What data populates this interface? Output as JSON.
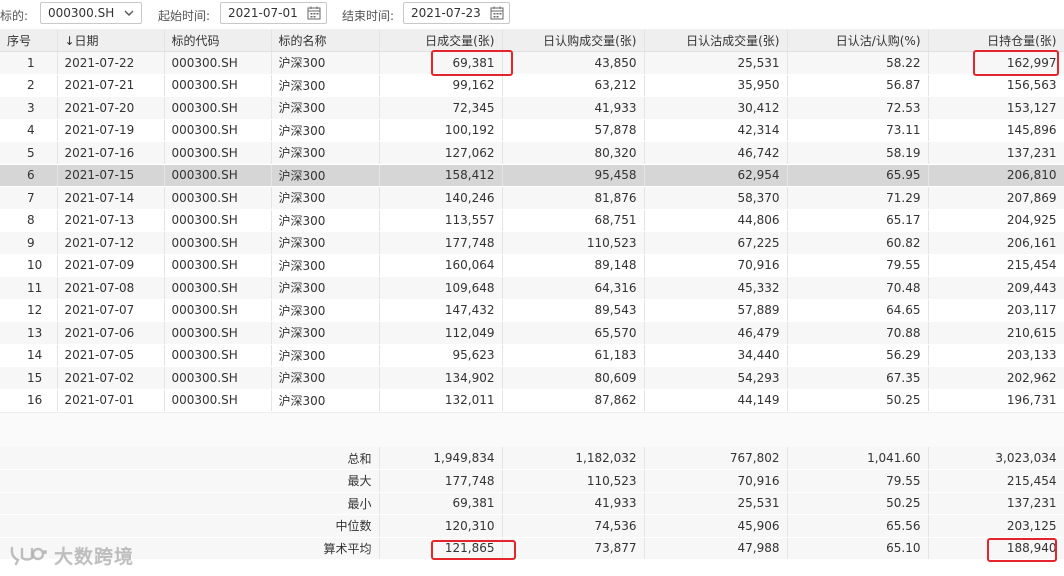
{
  "toolbar": {
    "symbol_label": "标的:",
    "symbol_value": "000300.SH",
    "start_label": "起始时间:",
    "start_date": "2021-07-01",
    "end_label": "结束时间:",
    "end_date": "2021-07-23"
  },
  "table": {
    "columns": [
      "序号",
      "↓日期",
      "标的代码",
      "标的名称",
      "日成交量(张)",
      "日认购成交量(张)",
      "日认沽成交量(张)",
      "日认沽/认购(%)",
      "日持仓量(张)"
    ],
    "sorted_column": "日期",
    "sort_direction": "desc",
    "selected_row": 6,
    "rows": [
      [
        "1",
        "2021-07-22",
        "000300.SH",
        "沪深300",
        "69,381",
        "43,850",
        "25,531",
        "58.22",
        "162,997"
      ],
      [
        "2",
        "2021-07-21",
        "000300.SH",
        "沪深300",
        "99,162",
        "63,212",
        "35,950",
        "56.87",
        "156,563"
      ],
      [
        "3",
        "2021-07-20",
        "000300.SH",
        "沪深300",
        "72,345",
        "41,933",
        "30,412",
        "72.53",
        "153,127"
      ],
      [
        "4",
        "2021-07-19",
        "000300.SH",
        "沪深300",
        "100,192",
        "57,878",
        "42,314",
        "73.11",
        "145,896"
      ],
      [
        "5",
        "2021-07-16",
        "000300.SH",
        "沪深300",
        "127,062",
        "80,320",
        "46,742",
        "58.19",
        "137,231"
      ],
      [
        "6",
        "2021-07-15",
        "000300.SH",
        "沪深300",
        "158,412",
        "95,458",
        "62,954",
        "65.95",
        "206,810"
      ],
      [
        "7",
        "2021-07-14",
        "000300.SH",
        "沪深300",
        "140,246",
        "81,876",
        "58,370",
        "71.29",
        "207,869"
      ],
      [
        "8",
        "2021-07-13",
        "000300.SH",
        "沪深300",
        "113,557",
        "68,751",
        "44,806",
        "65.17",
        "204,925"
      ],
      [
        "9",
        "2021-07-12",
        "000300.SH",
        "沪深300",
        "177,748",
        "110,523",
        "67,225",
        "60.82",
        "206,161"
      ],
      [
        "10",
        "2021-07-09",
        "000300.SH",
        "沪深300",
        "160,064",
        "89,148",
        "70,916",
        "79.55",
        "215,454"
      ],
      [
        "11",
        "2021-07-08",
        "000300.SH",
        "沪深300",
        "109,648",
        "64,316",
        "45,332",
        "70.48",
        "209,443"
      ],
      [
        "12",
        "2021-07-07",
        "000300.SH",
        "沪深300",
        "147,432",
        "89,543",
        "57,889",
        "64.65",
        "203,117"
      ],
      [
        "13",
        "2021-07-06",
        "000300.SH",
        "沪深300",
        "112,049",
        "65,570",
        "46,479",
        "70.88",
        "210,615"
      ],
      [
        "14",
        "2021-07-05",
        "000300.SH",
        "沪深300",
        "95,623",
        "61,183",
        "34,440",
        "56.29",
        "203,133"
      ],
      [
        "15",
        "2021-07-02",
        "000300.SH",
        "沪深300",
        "134,902",
        "80,609",
        "54,293",
        "67.35",
        "202,962"
      ],
      [
        "16",
        "2021-07-01",
        "000300.SH",
        "沪深300",
        "132,011",
        "87,862",
        "44,149",
        "50.25",
        "196,731"
      ]
    ]
  },
  "summary": [
    {
      "label": "总和",
      "values": [
        "1,949,834",
        "1,182,032",
        "767,802",
        "1,041.60",
        "3,023,034"
      ]
    },
    {
      "label": "最大",
      "values": [
        "177,748",
        "110,523",
        "70,916",
        "79.55",
        "215,454"
      ]
    },
    {
      "label": "最小",
      "values": [
        "69,381",
        "41,933",
        "25,531",
        "50.25",
        "137,231"
      ]
    },
    {
      "label": "中位数",
      "values": [
        "120,310",
        "74,536",
        "45,906",
        "65.56",
        "203,125"
      ]
    },
    {
      "label": "算术平均",
      "values": [
        "121,865",
        "73,877",
        "47,988",
        "65.10",
        "188,940"
      ]
    }
  ],
  "watermark_text": "大数跨境",
  "colors": {
    "highlight_border": "#e4252b",
    "header_bg": "#efefef",
    "stripe_bg": "#f7f7f7",
    "selected_bg": "#d6d6d6"
  },
  "icons": {
    "symbol_dropdown": "chevron-down-icon",
    "date_picker": "calendar-icon",
    "watermark_logo": "logo-icon"
  }
}
